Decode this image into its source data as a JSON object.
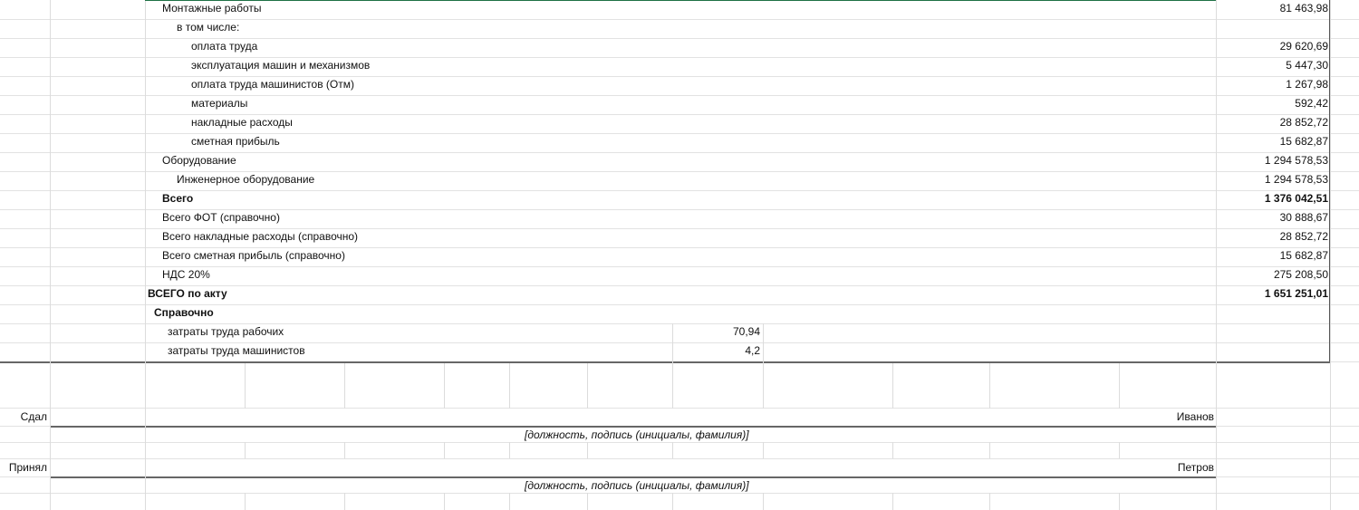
{
  "rows": [
    {
      "label": "Монтажные работы",
      "value": "81 463,98"
    },
    {
      "label": "в том числе:",
      "value": ""
    },
    {
      "label": "оплата труда",
      "value": "29 620,69"
    },
    {
      "label": "эксплуатация машин и механизмов",
      "value": "5 447,30"
    },
    {
      "label": "оплата труда машинистов (Отм)",
      "value": "1 267,98"
    },
    {
      "label": "материалы",
      "value": "592,42"
    },
    {
      "label": "накладные расходы",
      "value": "28 852,72"
    },
    {
      "label": "сметная прибыль",
      "value": "15 682,87"
    },
    {
      "label": "Оборудование",
      "value": "1 294 578,53"
    },
    {
      "label": "Инженерное оборудование",
      "value": "1 294 578,53"
    },
    {
      "label": "Всего",
      "value": "1 376 042,51"
    },
    {
      "label": "Всего ФОТ (справочно)",
      "value": "30 888,67"
    },
    {
      "label": "Всего накладные расходы (справочно)",
      "value": "28 852,72"
    },
    {
      "label": "Всего сметная прибыль (справочно)",
      "value": "15 682,87"
    },
    {
      "label": "НДС 20%",
      "value": "275 208,50"
    },
    {
      "label": "ВСЕГО по акту",
      "value": "1 651 251,01"
    },
    {
      "label": "Справочно",
      "value": ""
    },
    {
      "label": "затраты труда рабочих",
      "value": "70,94"
    },
    {
      "label": "затраты труда машинистов",
      "value": "4,2"
    }
  ],
  "signatures": [
    {
      "role": "Сдал",
      "name": "Иванов",
      "hint": "[должность, подпись (инициалы, фамилия)]"
    },
    {
      "role": "Принял",
      "name": "Петров",
      "hint": "[должность, подпись (инициалы, фамилия)]"
    }
  ],
  "colors": {
    "accent": "#1e7145",
    "border": "#555555",
    "grid": "#e2e2e2"
  }
}
